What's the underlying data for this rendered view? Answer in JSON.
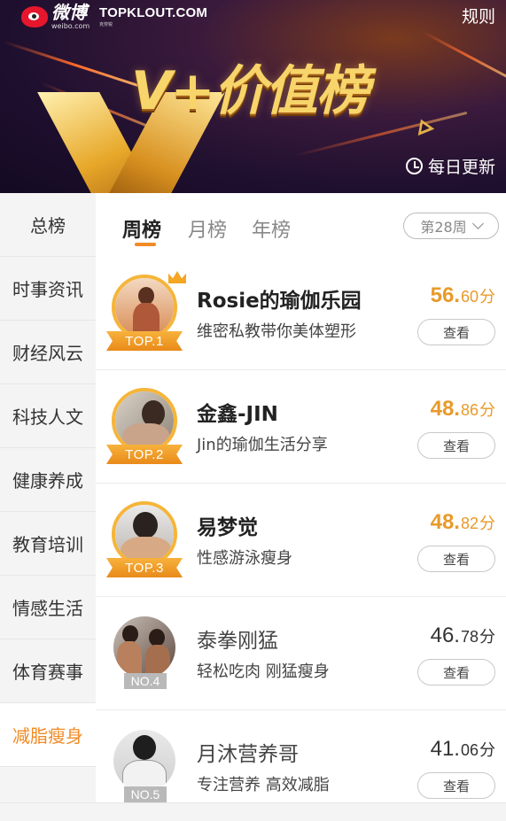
{
  "banner": {
    "weibo_cn": "微博",
    "weibo_en": "weibo.com",
    "partner_brand": "TOPKLOUT.COM",
    "partner_sub": "克劳锐",
    "rules_label": "规则",
    "title": "V+价值榜",
    "update_label": "每日更新",
    "accent_color": "#f08a24"
  },
  "sidebar": {
    "items": [
      {
        "label": "总榜"
      },
      {
        "label": "时事资讯"
      },
      {
        "label": "财经风云"
      },
      {
        "label": "科技人文"
      },
      {
        "label": "健康养成"
      },
      {
        "label": "教育培训"
      },
      {
        "label": "情感生活"
      },
      {
        "label": "体育赛事"
      },
      {
        "label": "减脂瘦身"
      }
    ],
    "active": "减脂瘦身"
  },
  "tabs": {
    "items": [
      {
        "label": "周榜"
      },
      {
        "label": "月榜"
      },
      {
        "label": "年榜"
      }
    ],
    "active": "周榜",
    "week_select": "第28周"
  },
  "list": {
    "button_label": "查看",
    "rows": [
      {
        "rank": "TOP.1",
        "name": "Rosie的瑜伽乐园",
        "desc": "维密私教带你美体塑形",
        "score_int": "56.",
        "score_dec": "60",
        "unit": "分"
      },
      {
        "rank": "TOP.2",
        "name": "金鑫-JIN",
        "desc": "Jin的瑜伽生活分享",
        "score_int": "48.",
        "score_dec": "86",
        "unit": "分"
      },
      {
        "rank": "TOP.3",
        "name": "易梦觉",
        "desc": "性感游泳瘦身",
        "score_int": "48.",
        "score_dec": "82",
        "unit": "分"
      },
      {
        "rank": "NO.4",
        "name": "泰拳刚猛",
        "desc": "轻松吃肉 刚猛瘦身",
        "score_int": "46.",
        "score_dec": "78",
        "unit": "分"
      },
      {
        "rank": "NO.5",
        "name": "月沐营养哥",
        "desc": "专注营养 高效减脂",
        "score_int": "41.",
        "score_dec": "06",
        "unit": "分"
      }
    ]
  }
}
